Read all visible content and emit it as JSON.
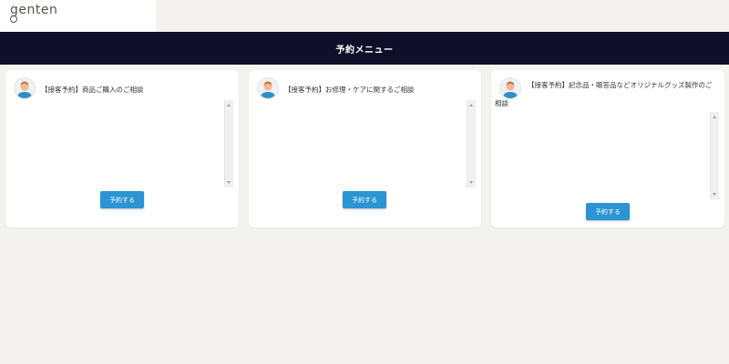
{
  "brand": {
    "logo_text": "genten"
  },
  "header": {
    "title": "予約メニュー"
  },
  "cards": [
    {
      "title": "【接客予約】商品ご購入のご相談",
      "button_label": "予約する"
    },
    {
      "title": "【接客予約】お修理・ケアに関するご相談",
      "button_label": "予約する"
    },
    {
      "title": "【接客予約】記念品・贈答品などオリジナルグッズ製作のご相談",
      "button_label": "予約する"
    }
  ],
  "colors": {
    "header_bg": "#0f0f2a",
    "page_bg": "#f4f2ee",
    "button_bg": "#2a95d2"
  },
  "icons": {
    "avatar": "staff-avatar-icon"
  }
}
